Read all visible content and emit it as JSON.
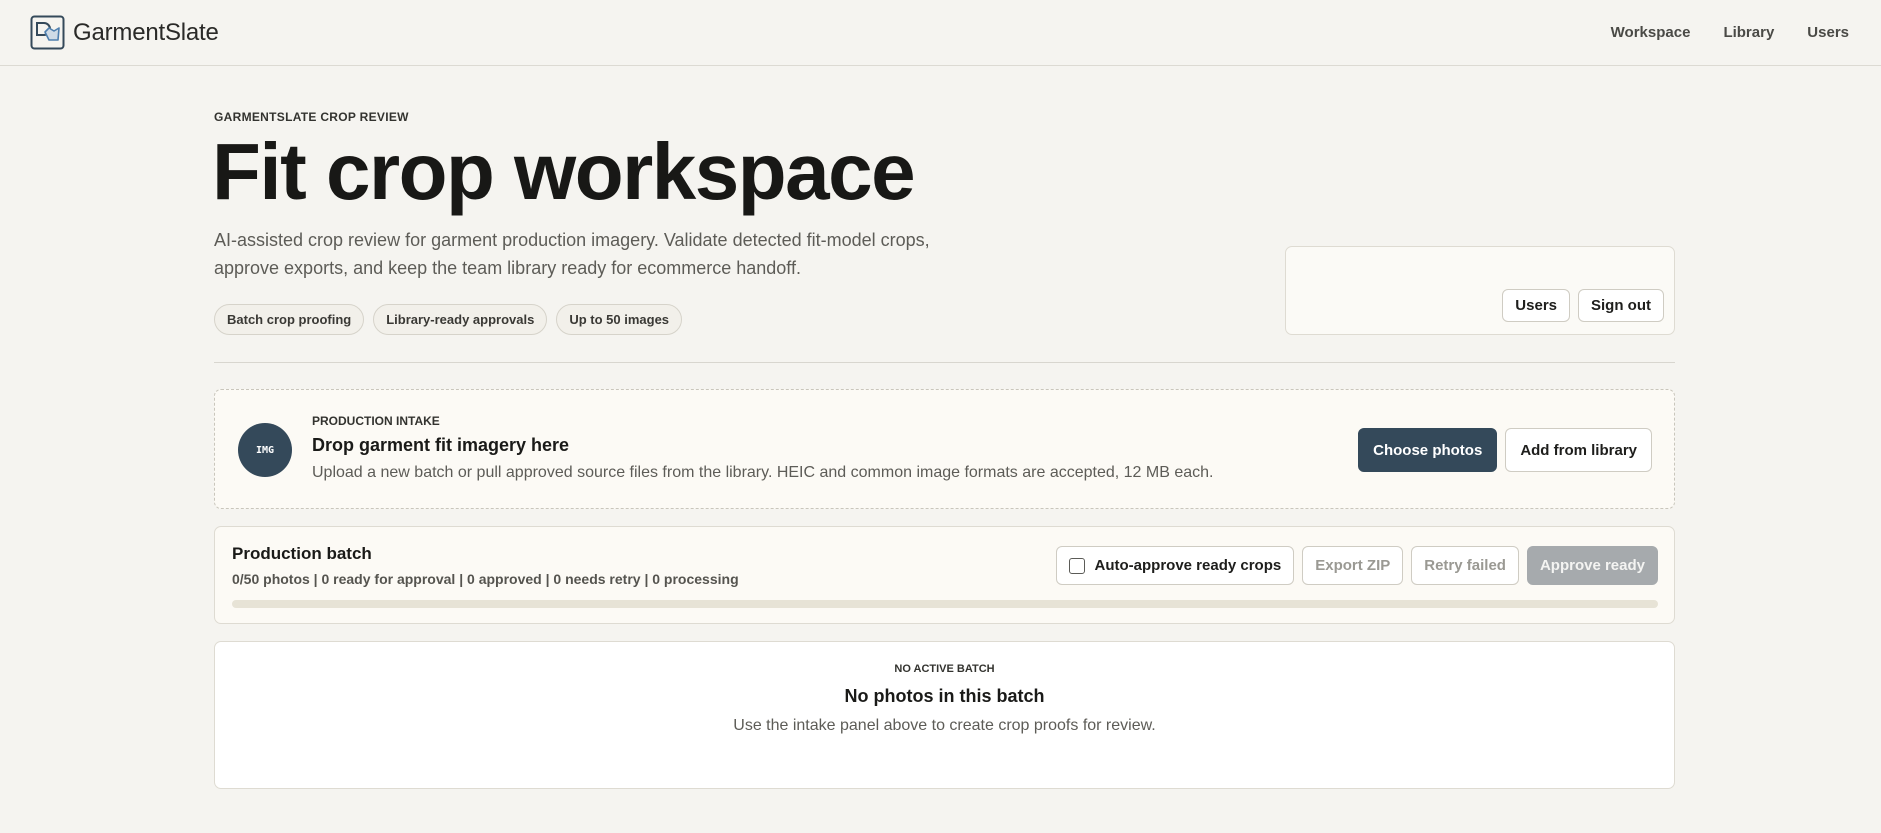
{
  "brand": {
    "name": "GarmentSlate",
    "logo_icon": "garment-logo-icon"
  },
  "nav": {
    "items": [
      {
        "label": "Workspace"
      },
      {
        "label": "Library"
      },
      {
        "label": "Users"
      }
    ]
  },
  "hero": {
    "eyebrow": "GARMENTSLATE CROP REVIEW",
    "title": "Fit crop workspace",
    "description": "AI-assisted crop review for garment production imagery. Validate detected fit-model crops, approve exports, and keep the team library ready for ecommerce handoff.",
    "pills": [
      {
        "label": "Batch crop proofing"
      },
      {
        "label": "Library-ready approvals"
      },
      {
        "label": "Up to 50 images"
      }
    ]
  },
  "account": {
    "users_label": "Users",
    "signout_label": "Sign out"
  },
  "intake": {
    "badge": "IMG",
    "eyebrow": "PRODUCTION INTAKE",
    "title": "Drop garment fit imagery here",
    "description": "Upload a new batch or pull approved source files from the library. HEIC and common image formats are accepted, 12 MB each.",
    "choose_label": "Choose photos",
    "library_label": "Add from library"
  },
  "batch": {
    "title": "Production batch",
    "stats": "0/50 photos | 0 ready for approval | 0 approved | 0 needs retry | 0 processing",
    "auto_approve_label": "Auto-approve ready crops",
    "auto_approve_checked": false,
    "export_label": "Export ZIP",
    "retry_label": "Retry failed",
    "approve_label": "Approve ready",
    "progress": 0
  },
  "empty_state": {
    "eyebrow": "NO ACTIVE BATCH",
    "title": "No photos in this batch",
    "description": "Use the intake panel above to create crop proofs for review."
  },
  "colors": {
    "background": "#f5f4f0",
    "accent": "#34495a",
    "disabled": "#a6aaad",
    "card": "#fcfaf5"
  }
}
